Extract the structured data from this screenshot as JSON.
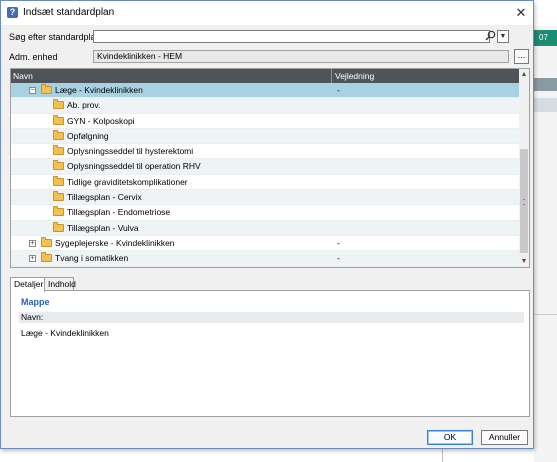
{
  "background": {
    "tab_number": "07"
  },
  "dialog": {
    "title": "Indsæt standardplan",
    "close_label": "✕",
    "search": {
      "label": "Søg efter standardplan:",
      "value": "",
      "placeholder": ""
    },
    "adm": {
      "label": "Adm. enhed",
      "value": "Kvindeklinikken - HEM",
      "browse_label": "..."
    },
    "grid": {
      "columns": [
        "Navn",
        "Vejledning"
      ],
      "rows": [
        {
          "level": 1,
          "expander": "−",
          "name": "Læge - Kvindeklinikken",
          "vejledning": "-",
          "selected": true
        },
        {
          "level": 2,
          "name": "Ab. prov.",
          "vejledning": ""
        },
        {
          "level": 2,
          "name": "GYN - Kolposkopi",
          "vejledning": ""
        },
        {
          "level": 2,
          "name": "Opfølgning",
          "vejledning": ""
        },
        {
          "level": 2,
          "name": "Oplysningsseddel til hysterektomi",
          "vejledning": ""
        },
        {
          "level": 2,
          "name": "Oplysningsseddel til operation RHV",
          "vejledning": ""
        },
        {
          "level": 2,
          "name": "Tidlige graviditetskomplikationer",
          "vejledning": ""
        },
        {
          "level": 2,
          "name": "Tillægsplan - Cervix",
          "vejledning": ""
        },
        {
          "level": 2,
          "name": "Tillægsplan - Endometriose",
          "vejledning": ""
        },
        {
          "level": 2,
          "name": "Tillægsplan - Vulva",
          "vejledning": ""
        },
        {
          "level": 1,
          "expander": "+",
          "name": "Sygeplejerske - Kvindeklinikken",
          "vejledning": "-"
        },
        {
          "level": 1,
          "expander": "+",
          "name": "Tvang i somatikken",
          "vejledning": "-"
        }
      ],
      "scroll_up": "▲",
      "scroll_down": "▼"
    },
    "tabs": [
      "Detaljer",
      "Indhold"
    ],
    "details": {
      "title": "Mappe",
      "field_label": "Navn:",
      "field_value": "Læge - Kvindeklinikken"
    },
    "buttons": {
      "ok": "OK",
      "cancel": "Annuller"
    }
  },
  "colors": {
    "header": "#4e5459",
    "selected_row": "#a8d2e2",
    "accent": "#3060b0"
  }
}
